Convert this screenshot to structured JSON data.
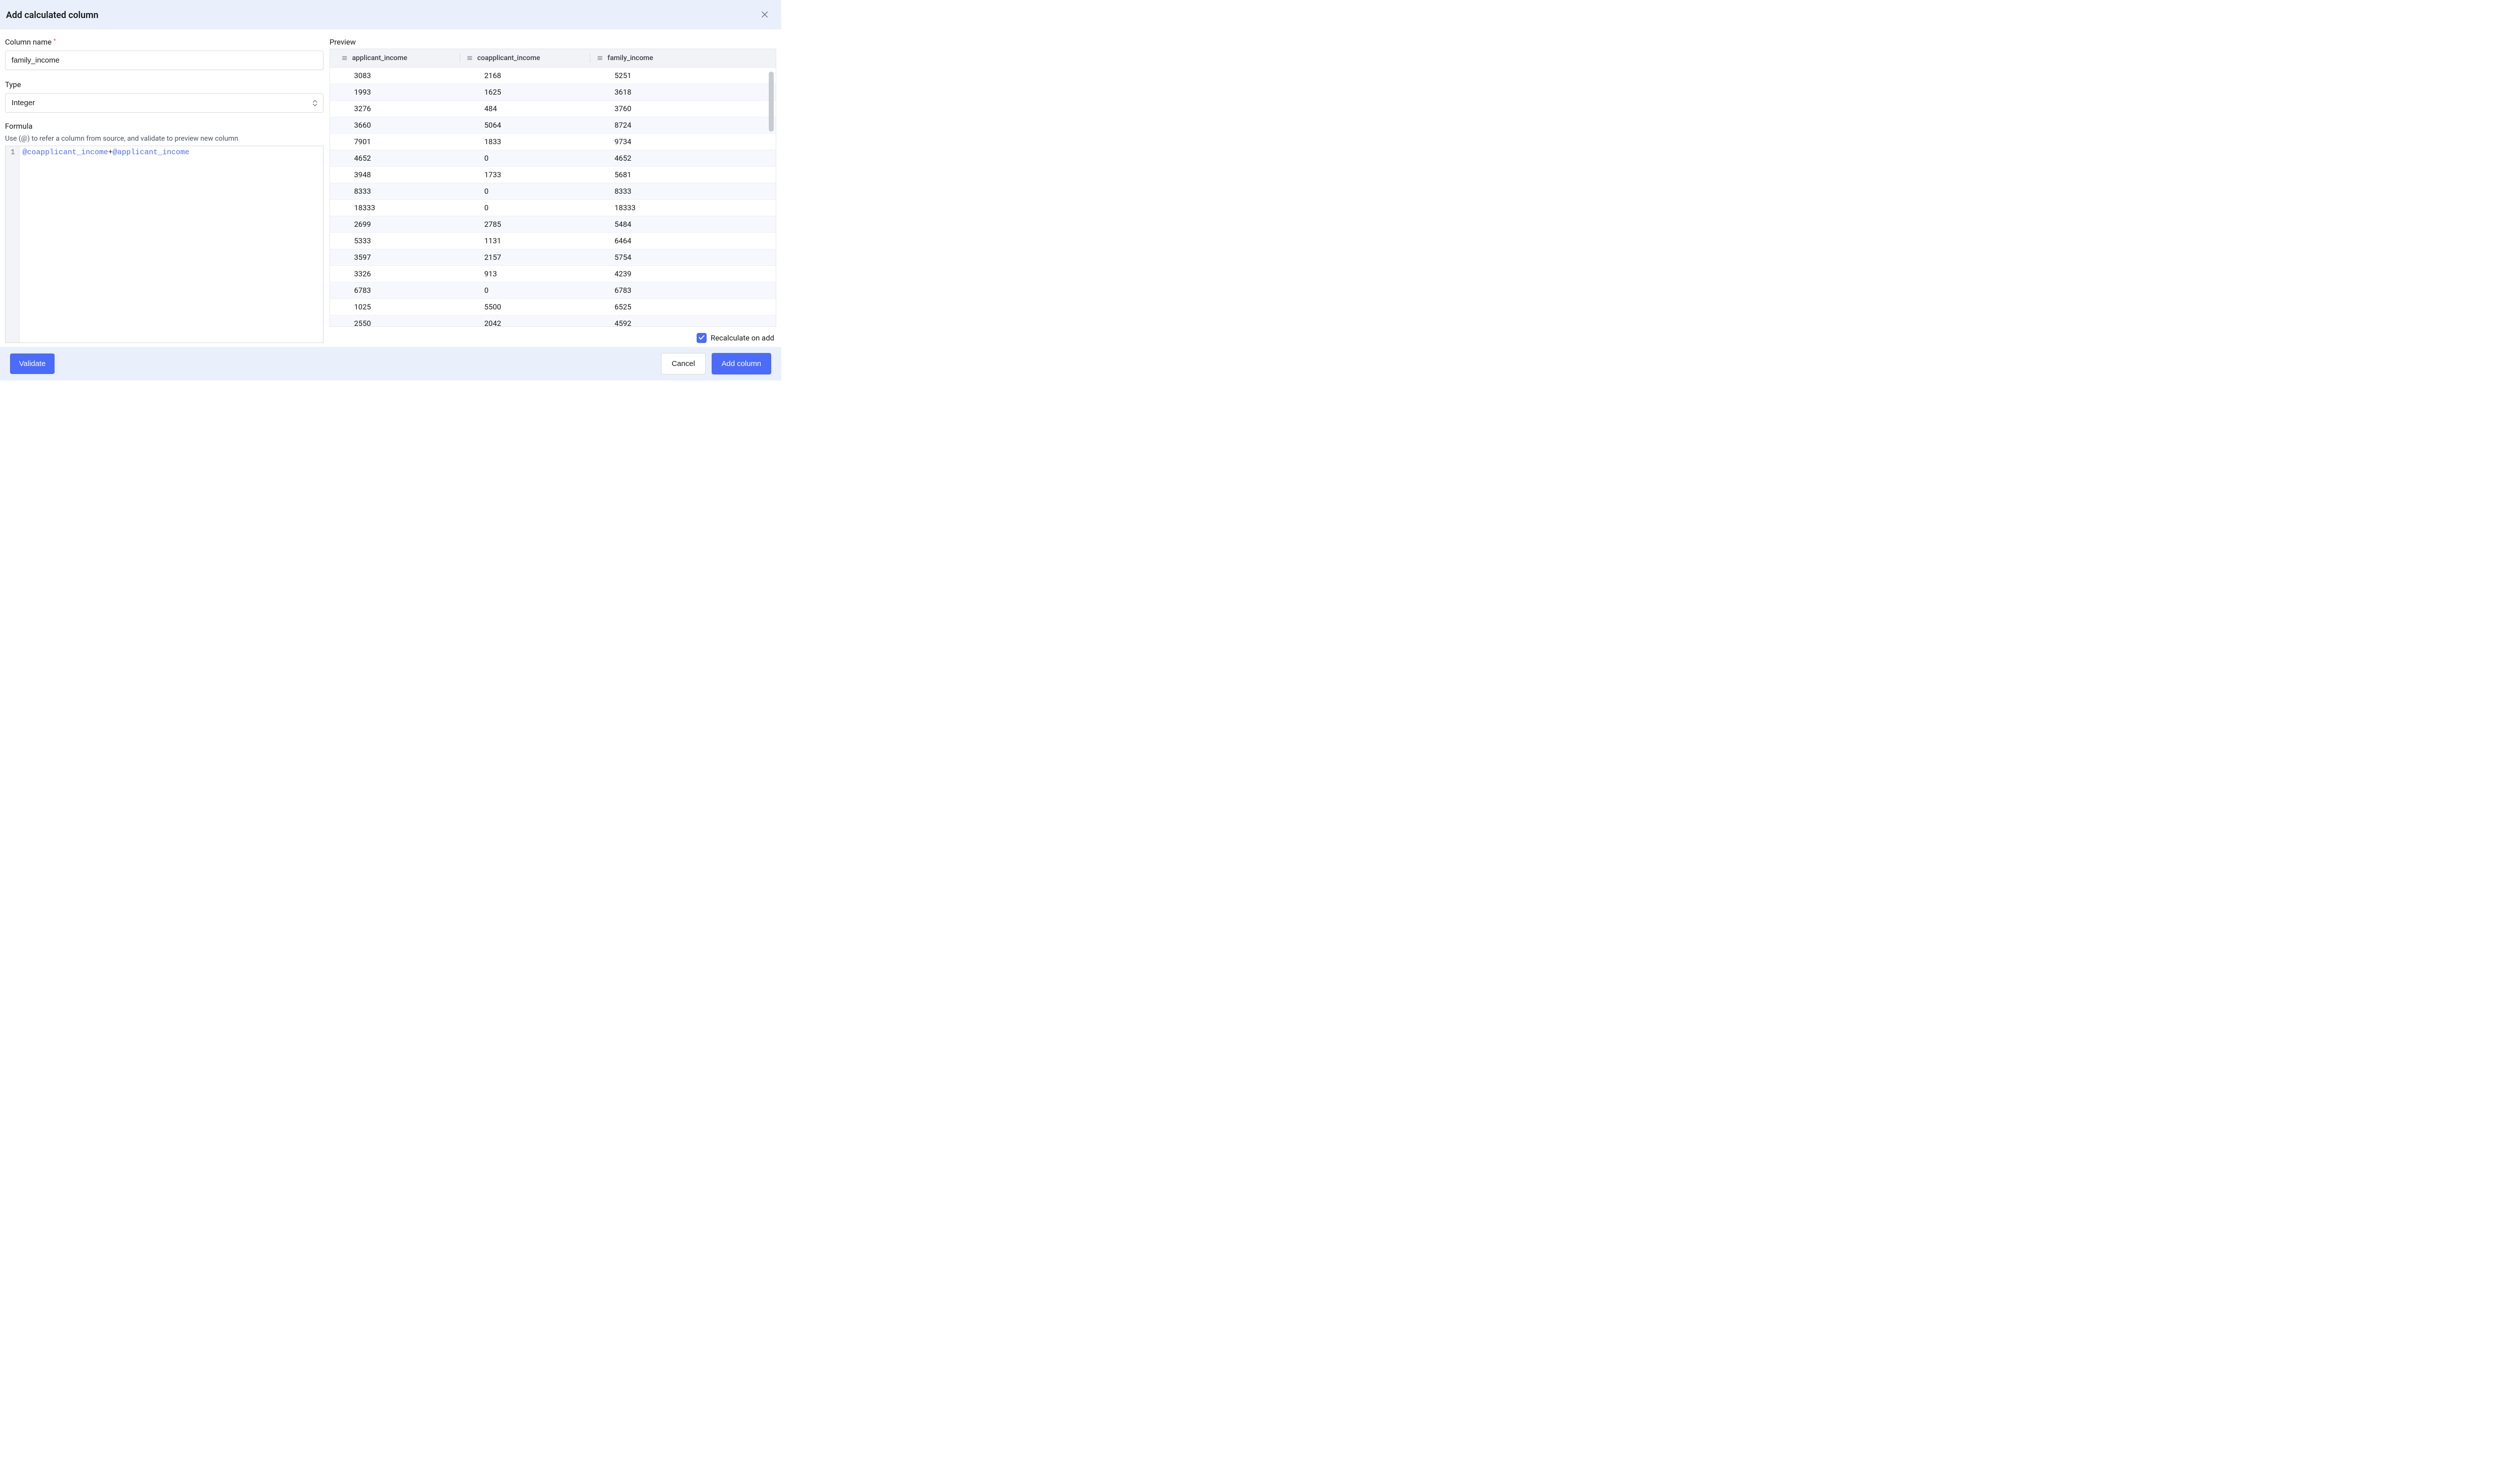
{
  "dialog": {
    "title": "Add calculated column"
  },
  "form": {
    "column_name_label": "Column name",
    "column_name_value": "family_income",
    "type_label": "Type",
    "type_value": "Integer",
    "formula_label": "Formula",
    "formula_helper": "Use (@) to refer a column from source, and validate to preview new column",
    "formula_line_number": "1",
    "formula_at1": "@",
    "formula_col1": "coapplicant_income",
    "formula_op": "+",
    "formula_at2": "@",
    "formula_col2": "applicant_income"
  },
  "preview": {
    "label": "Preview",
    "columns": [
      "applicant_income",
      "coapplicant_income",
      "family_income"
    ],
    "rows": [
      [
        "3083",
        "2168",
        "5251"
      ],
      [
        "1993",
        "1625",
        "3618"
      ],
      [
        "3276",
        "484",
        "3760"
      ],
      [
        "3660",
        "5064",
        "8724"
      ],
      [
        "7901",
        "1833",
        "9734"
      ],
      [
        "4652",
        "0",
        "4652"
      ],
      [
        "3948",
        "1733",
        "5681"
      ],
      [
        "8333",
        "0",
        "8333"
      ],
      [
        "18333",
        "0",
        "18333"
      ],
      [
        "2699",
        "2785",
        "5484"
      ],
      [
        "5333",
        "1131",
        "6464"
      ],
      [
        "3597",
        "2157",
        "5754"
      ],
      [
        "3326",
        "913",
        "4239"
      ],
      [
        "6783",
        "0",
        "6783"
      ],
      [
        "1025",
        "5500",
        "6525"
      ],
      [
        "2550",
        "2042",
        "4592"
      ]
    ],
    "recalc_label": "Recalculate on add",
    "recalc_checked": true
  },
  "footer": {
    "validate": "Validate",
    "cancel": "Cancel",
    "add": "Add column"
  }
}
